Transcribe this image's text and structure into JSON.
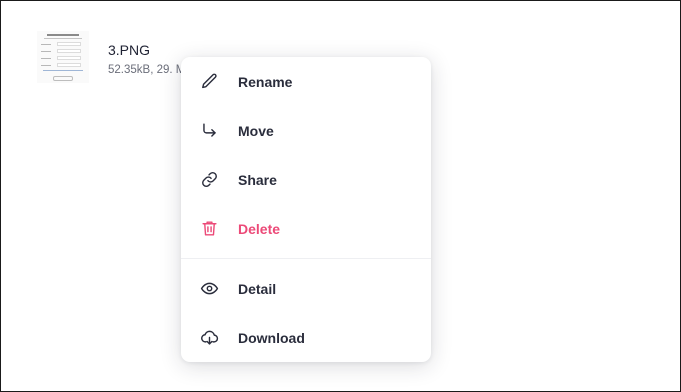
{
  "file": {
    "name": "3.PNG",
    "meta": "52.35kB, 29. M",
    "thumbnail_icon": "form-screenshot-thumbnail"
  },
  "menu": {
    "items": [
      {
        "label": "Rename",
        "icon": "pencil-icon",
        "color": "#2a2d3c"
      },
      {
        "label": "Move",
        "icon": "arrow-turn-down-right-icon",
        "color": "#2a2d3c"
      },
      {
        "label": "Share",
        "icon": "link-icon",
        "color": "#2a2d3c"
      },
      {
        "label": "Delete",
        "icon": "trash-icon",
        "color": "#ec4a78"
      },
      {
        "label": "Detail",
        "icon": "eye-icon",
        "color": "#2a2d3c"
      },
      {
        "label": "Download",
        "icon": "cloud-download-icon",
        "color": "#2a2d3c"
      }
    ]
  },
  "colors": {
    "text": "#2a2d3c",
    "danger": "#ec4a78",
    "meta": "#6b6e7a"
  }
}
